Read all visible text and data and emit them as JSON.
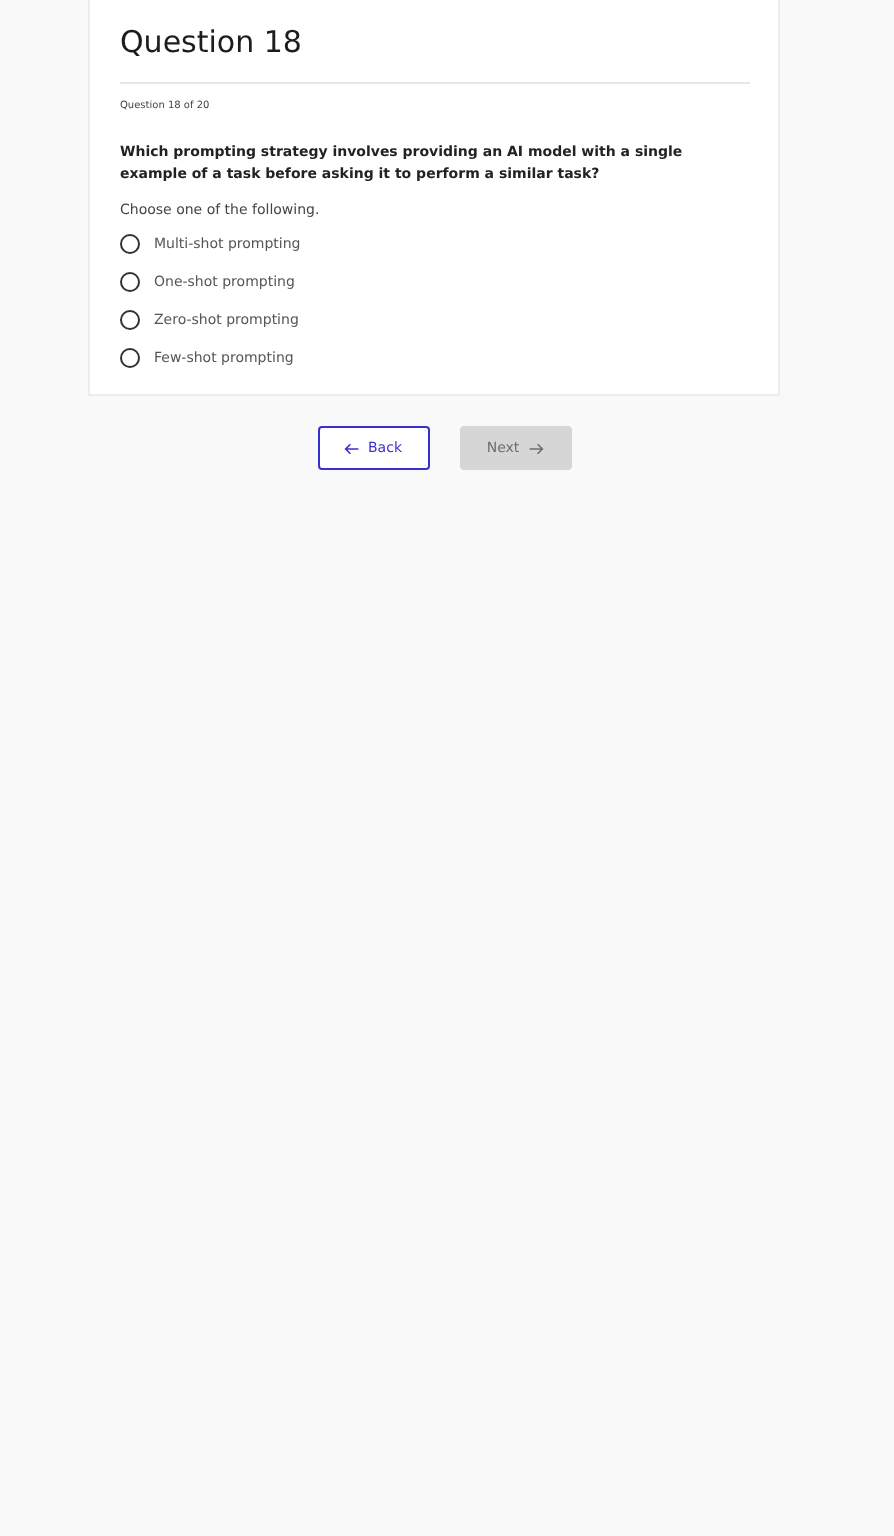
{
  "title": "Question 18",
  "progress": "Question 18 of 20",
  "question": "Which prompting strategy involves providing an AI model with a single example of a task before asking it to perform a similar task?",
  "instruction": "Choose one of the following.",
  "options": [
    {
      "label": "Multi-shot prompting",
      "selected": false
    },
    {
      "label": "One-shot prompting",
      "selected": false
    },
    {
      "label": "Zero-shot prompting",
      "selected": false
    },
    {
      "label": "Few-shot prompting",
      "selected": false
    }
  ],
  "buttons": [
    {
      "label": "Back",
      "kind": "back",
      "disabled": false
    },
    {
      "label": "Next",
      "kind": "next",
      "disabled": true
    }
  ]
}
